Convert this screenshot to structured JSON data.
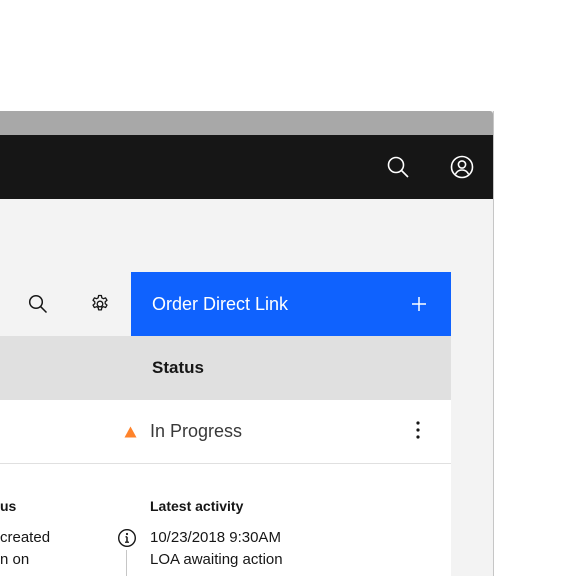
{
  "header": {
    "search_icon": "search-icon",
    "user_icon": "user-avatar-icon"
  },
  "toolbar": {
    "search_icon": "search-icon",
    "settings_icon": "gear-icon",
    "primary_button_label": "Order Direct Link",
    "primary_button_icon": "add-icon"
  },
  "table": {
    "columns": [
      "Status"
    ],
    "rows": [
      {
        "status": "In Progress",
        "status_icon": "warning-triangle-icon"
      }
    ]
  },
  "expanded": {
    "left_heading_fragment": "us",
    "left_line1_fragment": "created",
    "left_line2_fragment": "n on",
    "latest_activity_heading": "Latest activity",
    "latest_activity_timestamp": "10/23/2018 9:30AM",
    "latest_activity_text": "LOA awaiting action"
  },
  "colors": {
    "header_bg": "#161616",
    "primary": "#0f62fe",
    "warning": "#ff832b",
    "table_header_bg": "#e0e0e0"
  }
}
